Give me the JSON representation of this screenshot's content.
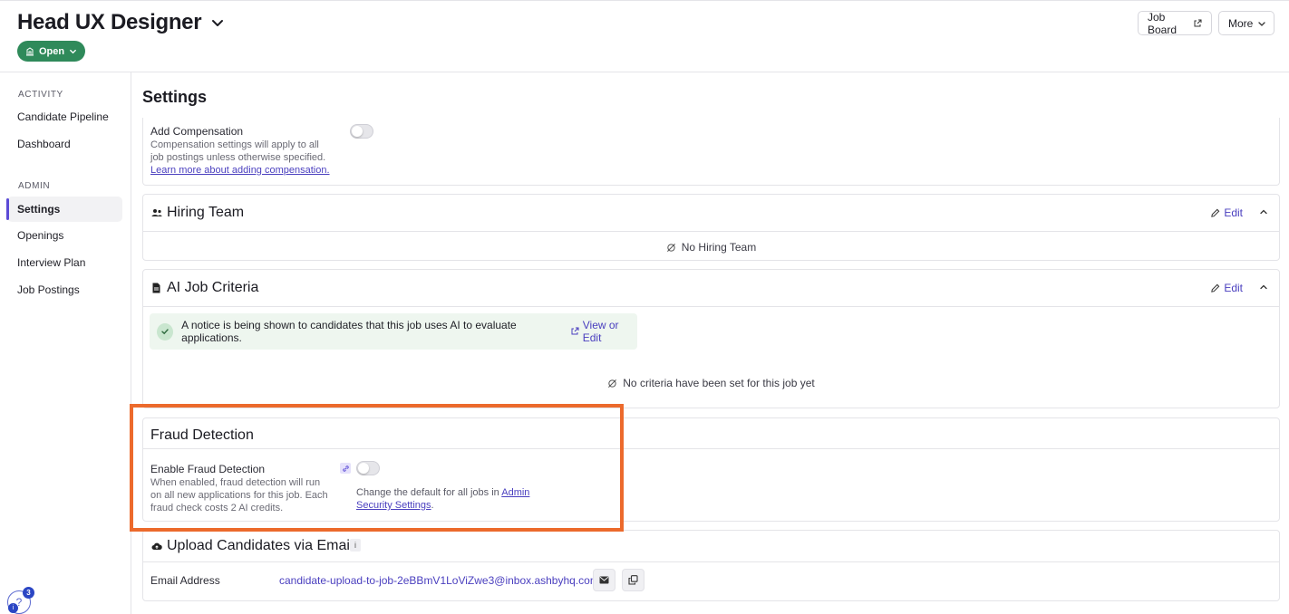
{
  "header": {
    "job_title": "Head UX Designer",
    "status": "Open",
    "job_board_label": "Job Board",
    "more_label": "More"
  },
  "sidebar": {
    "activity_label": "ACTIVITY",
    "activity_items": [
      "Candidate Pipeline",
      "Dashboard"
    ],
    "admin_label": "ADMIN",
    "admin_items": [
      "Settings",
      "Openings",
      "Interview Plan",
      "Job Postings"
    ],
    "active_item": "Settings",
    "help_badge_count": "3"
  },
  "main": {
    "page_title": "Settings",
    "compensation": {
      "label": "Add Compensation",
      "description": "Compensation settings will apply to all job postings unless otherwise specified.",
      "link_text": "Learn more about adding compensation.",
      "enabled": false
    },
    "hiring_team": {
      "title": "Hiring Team",
      "edit_label": "Edit",
      "empty_text": "No Hiring Team"
    },
    "ai_criteria": {
      "title": "AI Job Criteria",
      "edit_label": "Edit",
      "notice_text": "A notice is being shown to candidates that this job uses AI to evaluate applications.",
      "notice_link": "View or Edit",
      "empty_text": "No criteria have been set for this job yet"
    },
    "fraud_detection": {
      "title": "Fraud Detection",
      "label": "Enable Fraud Detection",
      "description": "When enabled, fraud detection will run on all new applications for this job. Each fraud check costs 2 AI credits.",
      "note_prefix": "Change the default for all jobs in ",
      "note_link": "Admin Security Settings",
      "note_suffix": ".",
      "enabled": false
    },
    "upload_email": {
      "title": "Upload Candidates via Email",
      "label": "Email Address",
      "email": "candidate-upload-to-job-2eBBmV1LoViZwe3@inbox.ashbyhq.com"
    }
  },
  "colors": {
    "accent": "#4a3fbf",
    "status_green": "#2f8a5a",
    "highlight": "#ec6a2c"
  }
}
